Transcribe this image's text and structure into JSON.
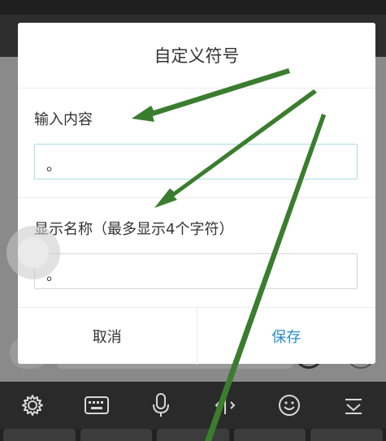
{
  "dialog": {
    "title": "自定义符号",
    "content_label": "输入内容",
    "content_value": "。",
    "name_label": "显示名称（最多显示4个字符）",
    "name_value": "。",
    "cancel_label": "取消",
    "save_label": "保存"
  },
  "colors": {
    "accent": "#2a8ec8",
    "arrow": "#3a7d2e",
    "focus_border": "#a8dde6"
  },
  "keyboard_toolbar": {
    "icons": [
      "gear-icon",
      "keyboard-icon",
      "microphone-icon",
      "text-cursor-icon",
      "emoji-icon",
      "collapse-keyboard-icon"
    ]
  }
}
